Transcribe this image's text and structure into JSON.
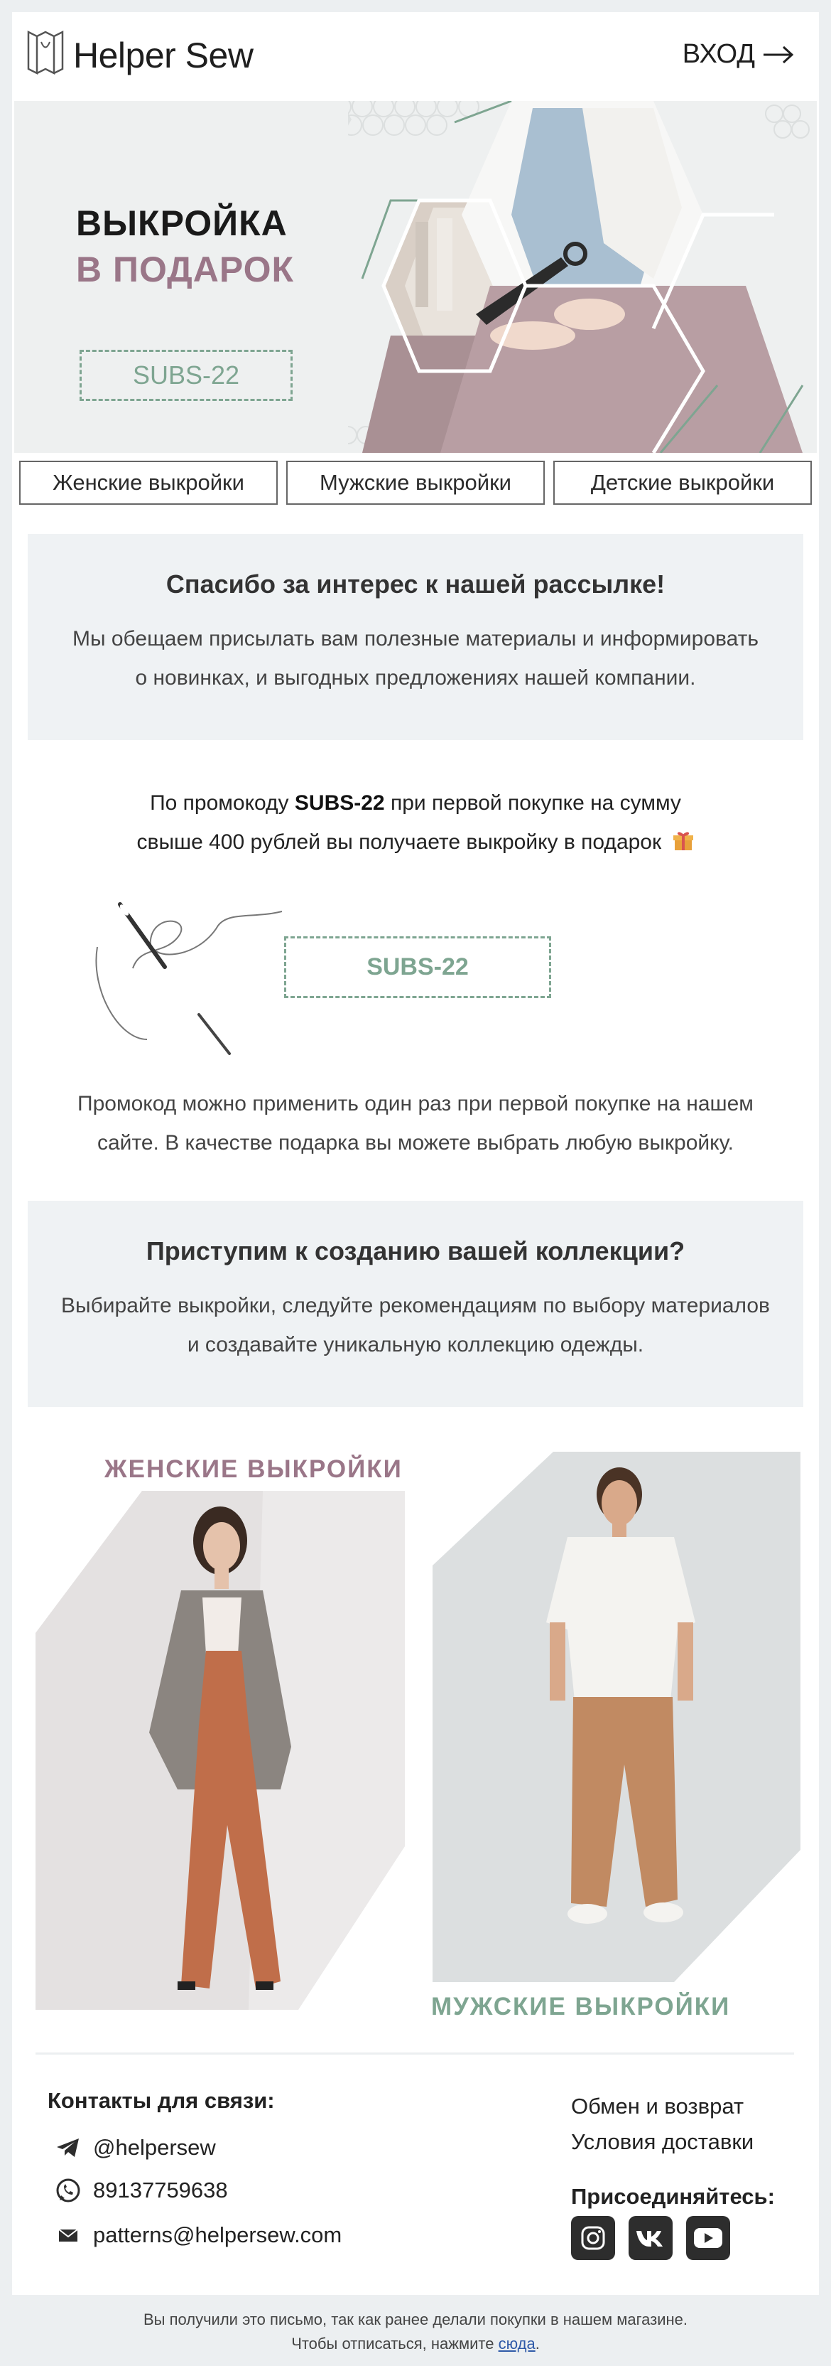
{
  "header": {
    "brand": "Helper Sew",
    "login_label": "ВХОД"
  },
  "hero": {
    "title_line1": "ВЫКРОЙКА",
    "title_line2": "В ПОДАРОК",
    "promo_code": "SUBS-22"
  },
  "categories": [
    {
      "label": "Женские выкройки"
    },
    {
      "label": "Мужские выкройки"
    },
    {
      "label": "Детские выкройки"
    }
  ],
  "thanks": {
    "title": "Спасибо за интерес к нашей рассылке!",
    "line1": "Мы обещаем присылать вам полезные материалы и информировать",
    "line2": "о новинках, и выгодных предложениях нашей компании."
  },
  "promo": {
    "prefix": "По промокоду ",
    "code": "SUBS-22",
    "suffix": " при первой покупке на сумму",
    "line2": "свыше 400 рублей вы получаете выкройку в подарок",
    "code_box": "SUBS-22",
    "note_line1": "Промокод можно применить один раз при первой покупке на нашем",
    "note_line2": "сайте. В качестве подарка вы можете выбрать любую выкройку."
  },
  "collection": {
    "title": "Приступим к созданию вашей коллекции?",
    "line1": "Выбирайте выкройки, следуйте рекомендациям по выбору материалов",
    "line2": "и создавайте уникальную коллекцию одежды."
  },
  "products": {
    "women_label": "ЖЕНСКИЕ ВЫКРОЙКИ",
    "men_label": "МУЖСКИЕ ВЫКРОЙКИ"
  },
  "footer": {
    "contacts_title": "Контакты для связи:",
    "telegram": "@helpersew",
    "whatsapp": "89137759638",
    "email": "patterns@helpersew.com",
    "link_returns": "Обмен и возврат",
    "link_delivery": "Условия доставки",
    "join_title": "Присоединяйтесь:",
    "social": [
      "instagram-icon",
      "vk-icon",
      "youtube-icon"
    ]
  },
  "legal": {
    "line1": "Вы получили это письмо, так как ранее делали покупки в нашем магазине.",
    "line2_prefix": "Чтобы отписаться, нажмите ",
    "unsubscribe": "сюда",
    "line2_suffix": "."
  },
  "colors": {
    "accent_mauve": "#9a7688",
    "accent_green": "#7ea591",
    "box_bg": "#eff2f4",
    "page_bg": "#eceff1"
  }
}
